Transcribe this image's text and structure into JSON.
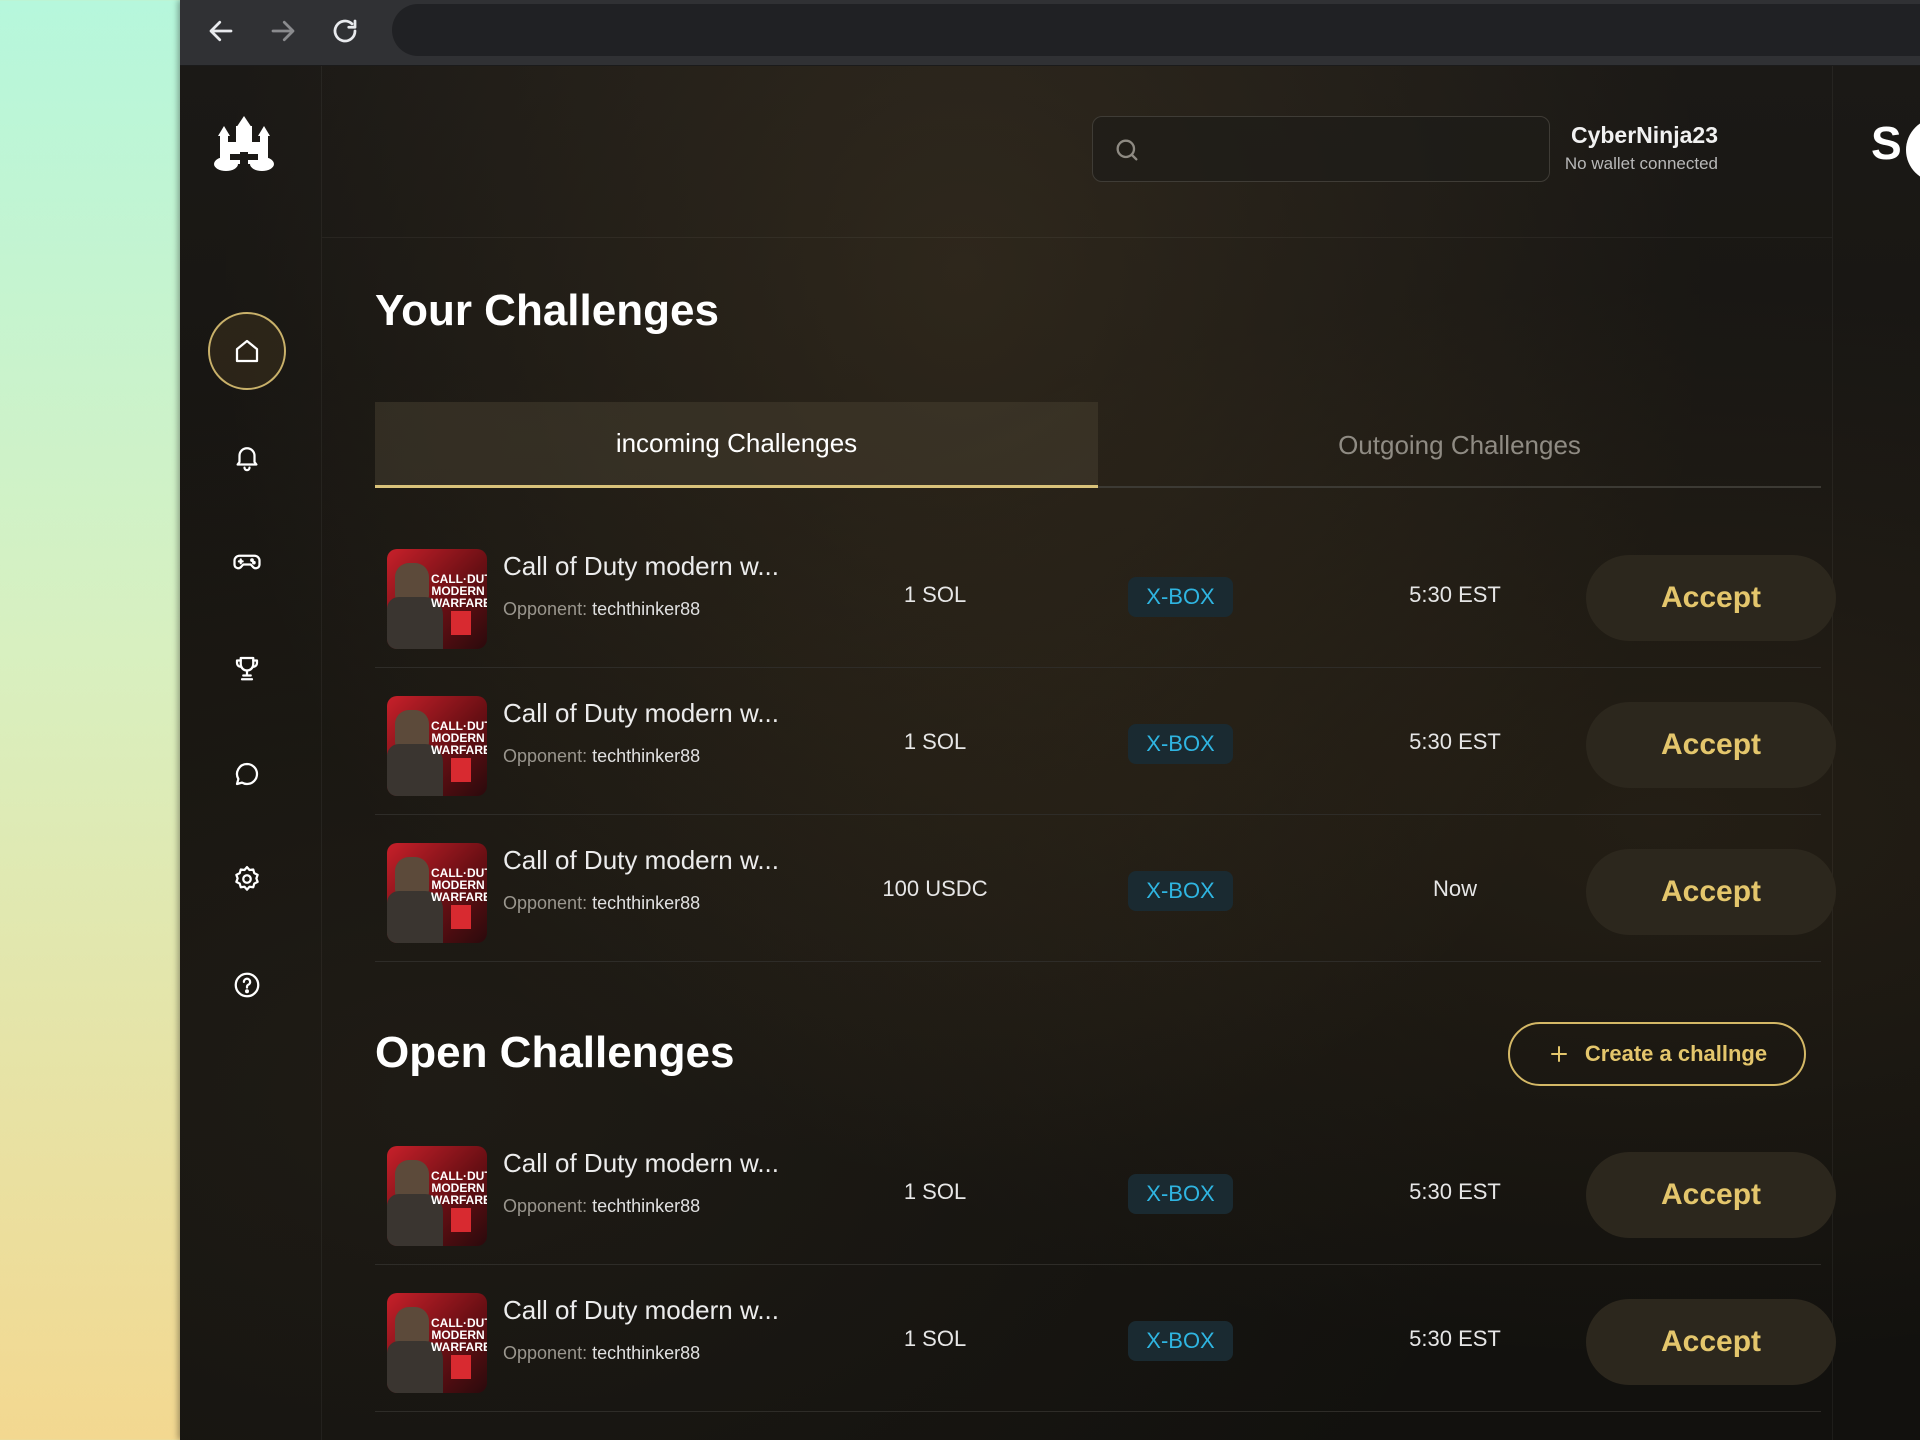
{
  "browser": {
    "back_icon": "arrow-left-icon",
    "forward_icon": "arrow-right-icon",
    "reload_icon": "reload-icon"
  },
  "header": {
    "search_placeholder": "",
    "user_name": "CyberNinja23",
    "wallet_status": "No wallet connected",
    "edge_text": "S"
  },
  "sidebar": {
    "items": [
      {
        "name": "home",
        "icon": "home-icon",
        "active": true
      },
      {
        "name": "notifications",
        "icon": "bell-icon",
        "active": false
      },
      {
        "name": "games",
        "icon": "gamepad-icon",
        "active": false
      },
      {
        "name": "tournaments",
        "icon": "trophy-icon",
        "active": false
      },
      {
        "name": "chat",
        "icon": "chat-icon",
        "active": false
      },
      {
        "name": "settings",
        "icon": "gear-icon",
        "active": false
      },
      {
        "name": "help",
        "icon": "help-icon",
        "active": false
      }
    ]
  },
  "your_challenges": {
    "title": "Your Challenges",
    "tabs": [
      "incoming Challenges",
      "Outgoing Challenges"
    ],
    "rows": [
      {
        "game": "Call of Duty modern w...",
        "opponent_label": "Opponent:",
        "opponent": "techthinker88",
        "amount": "1 SOL",
        "platform": "X-BOX",
        "time": "5:30 EST",
        "action": "Accept"
      },
      {
        "game": "Call of Duty modern w...",
        "opponent_label": "Opponent:",
        "opponent": "techthinker88",
        "amount": "1 SOL",
        "platform": "X-BOX",
        "time": "5:30 EST",
        "action": "Accept"
      },
      {
        "game": "Call of Duty modern w...",
        "opponent_label": "Opponent:",
        "opponent": "techthinker88",
        "amount": "100 USDC",
        "platform": "X-BOX",
        "time": "Now",
        "action": "Accept"
      }
    ]
  },
  "open_challenges": {
    "title": "Open Challenges",
    "create_label": "Create a challnge",
    "rows": [
      {
        "game": "Call of Duty modern w...",
        "opponent_label": "Opponent:",
        "opponent": "techthinker88",
        "amount": "1 SOL",
        "platform": "X-BOX",
        "time": "5:30 EST",
        "action": "Accept"
      },
      {
        "game": "Call of Duty modern w...",
        "opponent_label": "Opponent:",
        "opponent": "techthinker88",
        "amount": "1 SOL",
        "platform": "X-BOX",
        "time": "5:30 EST",
        "action": "Accept"
      }
    ]
  },
  "game_cover": {
    "line1": "CALL·DUTY",
    "line2": "MODERN",
    "line3": "WARFARE"
  },
  "colors": {
    "accent_gold": "#e4c66c",
    "platform_blue": "#2fb5e1",
    "background": "#15130f"
  }
}
